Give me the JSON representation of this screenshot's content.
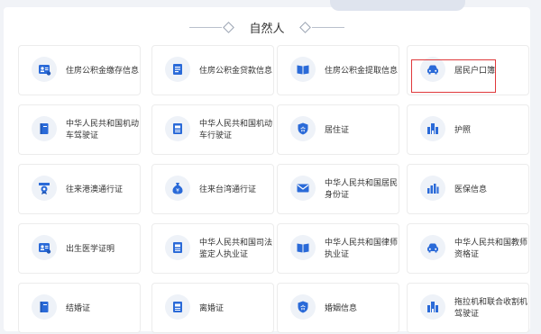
{
  "section_title": "自然人",
  "colors": {
    "accent": "#2a6ad8",
    "highlight": "#e0393b"
  },
  "cards": [
    {
      "label": "住房公积金缴存信息",
      "icon": "id-card-icon"
    },
    {
      "label": "住房公积金贷款信息",
      "icon": "book-icon"
    },
    {
      "label": "住房公积金提取信息",
      "icon": "open-book-icon"
    },
    {
      "label": "居民户口簿",
      "icon": "car-icon"
    },
    {
      "label": "中华人民共和国机动车驾驶证",
      "icon": "booklet-icon"
    },
    {
      "label": "中华人民共和国机动车行驶证",
      "icon": "document-icon"
    },
    {
      "label": "居住证",
      "icon": "shield-icon"
    },
    {
      "label": "护照",
      "icon": "building-icon"
    },
    {
      "label": "往来港澳通行证",
      "icon": "award-icon"
    },
    {
      "label": "往来台湾通行证",
      "icon": "money-bag-icon"
    },
    {
      "label": "中华人民共和国居民身份证",
      "icon": "mail-icon"
    },
    {
      "label": "医保信息",
      "icon": "bar-chart-icon"
    },
    {
      "label": "出生医学证明",
      "icon": "id-card-icon"
    },
    {
      "label": "中华人民共和国司法鉴定人执业证",
      "icon": "document-icon"
    },
    {
      "label": "中华人民共和国律师执业证",
      "icon": "open-book-icon"
    },
    {
      "label": "中华人民共和国教师资格证",
      "icon": "car-icon"
    },
    {
      "label": "结婚证",
      "icon": "booklet-icon"
    },
    {
      "label": "离婚证",
      "icon": "document-icon"
    },
    {
      "label": "婚姻信息",
      "icon": "shield-icon"
    },
    {
      "label": "拖拉机和联合收割机驾驶证",
      "icon": "building-icon"
    }
  ]
}
